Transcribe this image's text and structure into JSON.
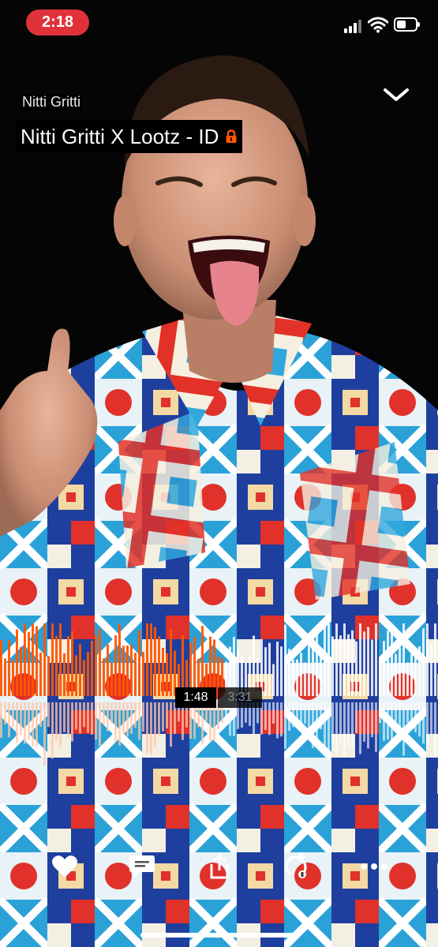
{
  "status_bar": {
    "time": "2:18"
  },
  "track": {
    "artist": "Nitti Gritti",
    "title": "Nitti Gritti X Lootz - ID"
  },
  "player": {
    "current_time": "1:48",
    "total_time": "3:31",
    "progress": 0.5118
  },
  "colors": {
    "accent": "#ff5500",
    "status_pill": "#e0323a"
  },
  "icons": {
    "title_badge": "lock-icon",
    "collapse": "chevron-down-icon",
    "actions": [
      "heart-icon",
      "comment-icon",
      "share-icon",
      "repost-icon",
      "more-icon"
    ]
  }
}
